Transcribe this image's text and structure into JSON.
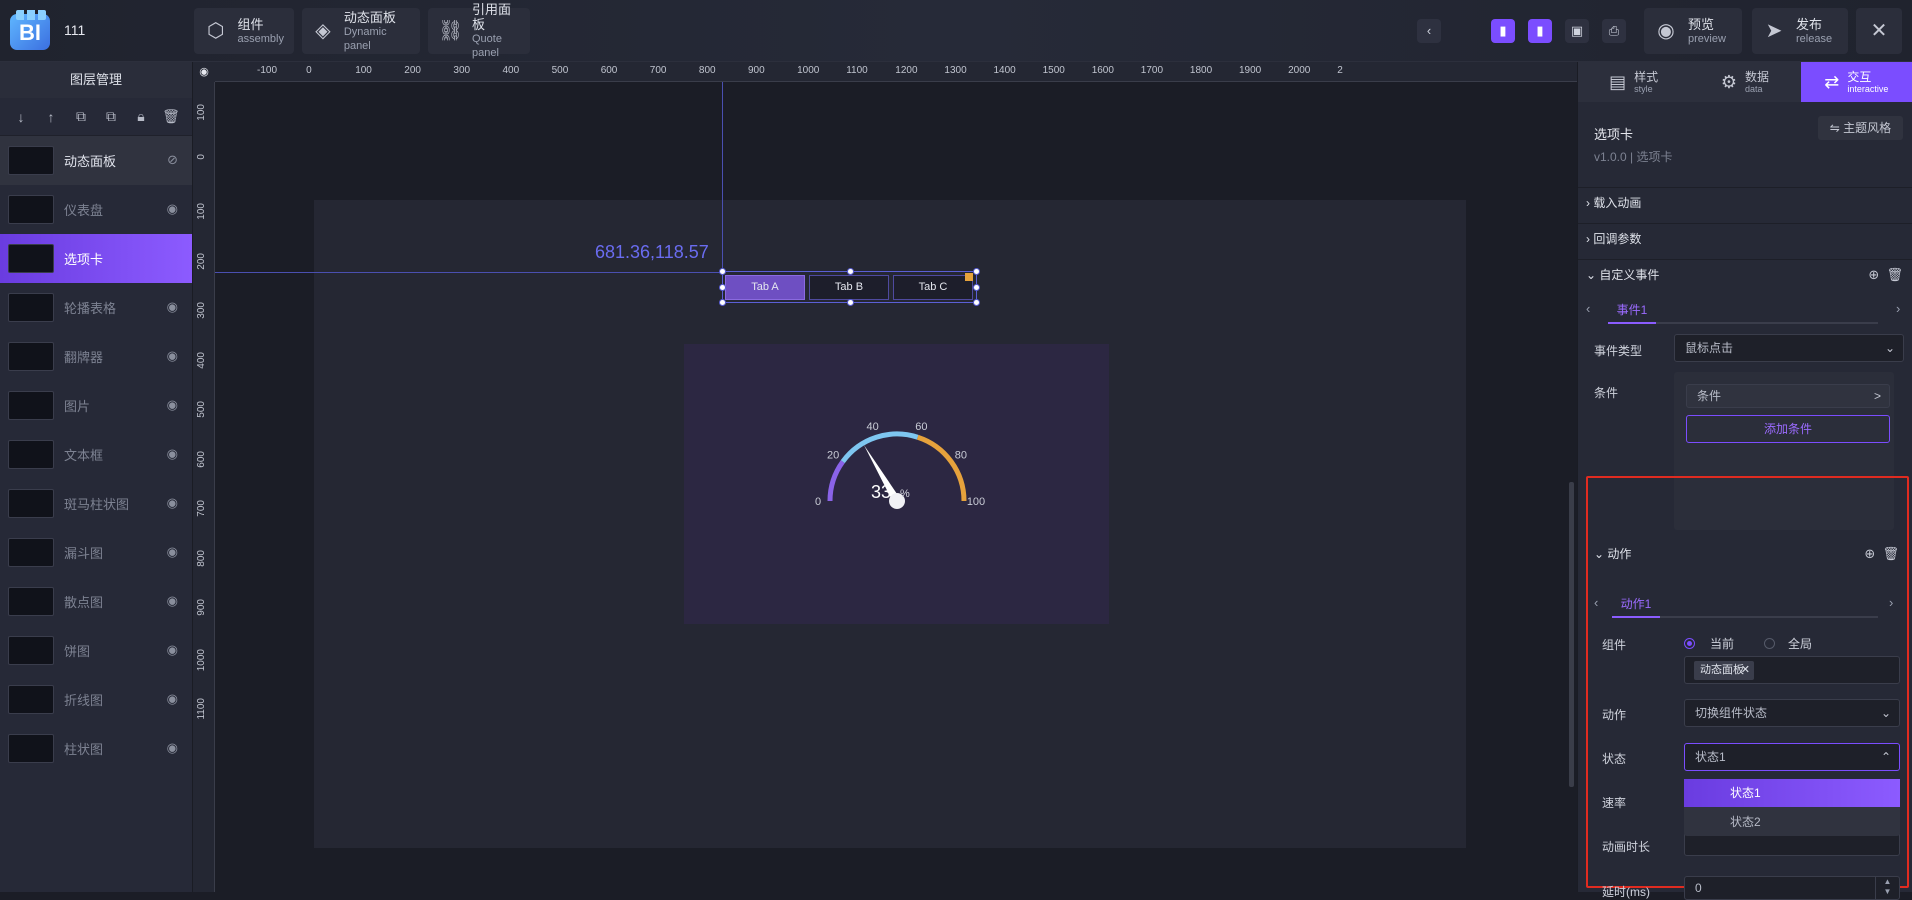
{
  "app": {
    "title": "111",
    "logo": "BI"
  },
  "toolbar": {
    "buttons": [
      {
        "icon": "assembly-icon",
        "label": "组件",
        "sub": "assembly"
      },
      {
        "icon": "layers-icon",
        "label": "动态面板",
        "sub": "Dynamic panel"
      },
      {
        "icon": "link-icon",
        "label": "引用面板",
        "sub": "Quote panel"
      }
    ],
    "preview": {
      "label": "预览",
      "sub": "preview"
    },
    "release": {
      "label": "发布",
      "sub": "release"
    }
  },
  "layers": {
    "title": "图层管理",
    "items": [
      {
        "name": "动态面板",
        "state": "hover"
      },
      {
        "name": "仪表盘",
        "state": "normal"
      },
      {
        "name": "选项卡",
        "state": "active"
      },
      {
        "name": "轮播表格",
        "state": "normal"
      },
      {
        "name": "翻牌器",
        "state": "normal"
      },
      {
        "name": "图片",
        "state": "normal"
      },
      {
        "name": "文本框",
        "state": "normal"
      },
      {
        "name": "斑马柱状图",
        "state": "normal"
      },
      {
        "name": "漏斗图",
        "state": "normal"
      },
      {
        "name": "散点图",
        "state": "normal"
      },
      {
        "name": "饼图",
        "state": "normal"
      },
      {
        "name": "折线图",
        "state": "normal"
      },
      {
        "name": "柱状图",
        "state": "normal"
      }
    ]
  },
  "ruler": {
    "h": [
      "-100",
      "0",
      "100",
      "200",
      "300",
      "400",
      "500",
      "600",
      "700",
      "800",
      "900",
      "1000",
      "1100",
      "1200",
      "1300",
      "1400",
      "1500",
      "1600",
      "1700",
      "1800",
      "1900",
      "2000",
      "2"
    ],
    "v": [
      "100",
      "0",
      "100",
      "200",
      "300",
      "400",
      "500",
      "600",
      "700",
      "800",
      "900",
      "1000",
      "1100"
    ]
  },
  "canvas": {
    "coords": "681.36,118.57",
    "tabs": [
      "Tab A",
      "Tab B",
      "Tab C"
    ],
    "gauge": {
      "value": 33,
      "unit": "%",
      "ticks": [
        "0",
        "20",
        "40",
        "60",
        "80",
        "100"
      ],
      "min": 0,
      "max": 100
    }
  },
  "panel": {
    "tabs": [
      {
        "label": "样式",
        "sub": "style",
        "icon": "style-icon"
      },
      {
        "label": "数据",
        "sub": "data",
        "icon": "gear-icon"
      },
      {
        "label": "交互",
        "sub": "interactive",
        "icon": "interactive-icon"
      }
    ],
    "component_title": "选项卡",
    "component_version": "v1.0.0 | 选项卡",
    "theme_button": "⇋ 主题风格",
    "sections": {
      "load_anim": "载入动画",
      "callback": "回调参数",
      "custom_event": "自定义事件",
      "action": "动作"
    },
    "event": {
      "tab": "事件1",
      "type_label": "事件类型",
      "type_value": "鼠标点击",
      "condition_label": "条件",
      "condition_value": "条件",
      "add_condition": "添加条件"
    },
    "action": {
      "tab": "动作1",
      "component_label": "组件",
      "radio_current": "当前",
      "radio_global": "全局",
      "chip": "动态面板",
      "action_label": "动作",
      "action_value": "切换组件状态",
      "state_label": "状态",
      "state_value": "状态1",
      "state_options": [
        "状态1",
        "状态2"
      ],
      "speed_label": "速率",
      "duration_label": "动画时长",
      "delay_label": "延时(ms)",
      "delay_value": "0"
    }
  },
  "colors": {
    "accent": "#7b4dff",
    "highlight_box": "#e02b20",
    "gauge_gold": "#e6a23c",
    "gauge_blue": "#7ec6f0",
    "gauge_purple": "#8a63e8"
  }
}
